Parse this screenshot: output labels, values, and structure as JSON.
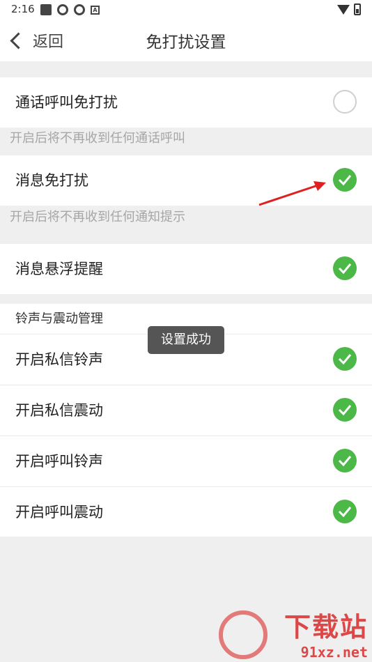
{
  "status_bar": {
    "time": "2:16"
  },
  "header": {
    "back_label": "返回",
    "title": "免打扰设置"
  },
  "settings": {
    "call_dnd": {
      "label": "通话呼叫免打扰",
      "enabled": false,
      "hint": "开启后将不再收到任何通话呼叫"
    },
    "msg_dnd": {
      "label": "消息免打扰",
      "enabled": true,
      "hint": "开启后将不再收到任何通知提示"
    },
    "float_reminder": {
      "label": "消息悬浮提醒",
      "enabled": true
    }
  },
  "ring_section": {
    "title": "铃声与震动管理",
    "items": [
      {
        "label": "开启私信铃声",
        "enabled": true
      },
      {
        "label": "开启私信震动",
        "enabled": true
      },
      {
        "label": "开启呼叫铃声",
        "enabled": true
      },
      {
        "label": "开启呼叫震动",
        "enabled": true
      }
    ]
  },
  "toast": {
    "text": "设置成功"
  },
  "watermark": {
    "text": "下载站",
    "domain": "91xz.net"
  },
  "colors": {
    "toggle_on": "#4cb848",
    "arrow": "#e02020"
  }
}
